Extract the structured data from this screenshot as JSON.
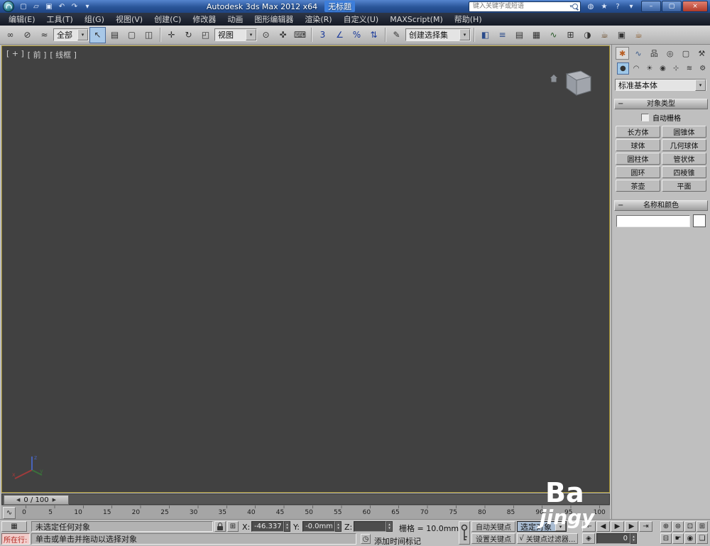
{
  "ui": {
    "arrow_down": "▾",
    "arrow_up": "▴",
    "arrow_left": "◀",
    "arrow_right": "▶",
    "collapse": "−",
    "listener_glyph": "▦",
    "absmode_glyph": "⊞",
    "clock_glyph": "◷",
    "keymode_glyph": "◈",
    "curve_glyph": "∿",
    "check": "√"
  },
  "titlebar": {
    "app_title": "Autodesk 3ds Max  2012 x64",
    "doc_title": "无标题",
    "search_placeholder": "键入关键字或短语",
    "qat_icons": [
      {
        "name": "new-scene-icon",
        "glyph": "▢"
      },
      {
        "name": "open-file-icon",
        "glyph": "▱"
      },
      {
        "name": "save-file-icon",
        "glyph": "▣"
      },
      {
        "name": "undo-icon",
        "glyph": "↶"
      },
      {
        "name": "redo-icon",
        "glyph": "↷"
      },
      {
        "name": "recent-dropdown-icon",
        "glyph": "▾"
      }
    ],
    "info_icons": [
      {
        "name": "communication-center-icon",
        "glyph": "◍"
      },
      {
        "name": "favorites-icon",
        "glyph": "★"
      },
      {
        "name": "help-icon",
        "glyph": "?"
      },
      {
        "name": "help-dropdown-icon",
        "glyph": "▾"
      }
    ],
    "window_buttons": [
      {
        "name": "minimize-button",
        "glyph": "–"
      },
      {
        "name": "maximize-button",
        "glyph": "▢"
      },
      {
        "name": "close-button",
        "glyph": "×",
        "cls": "close"
      }
    ]
  },
  "menus": [
    "编辑(E)",
    "工具(T)",
    "组(G)",
    "视图(V)",
    "创建(C)",
    "修改器",
    "动画",
    "图形编辑器",
    "渲染(R)",
    "自定义(U)",
    "MAXScript(M)",
    "帮助(H)"
  ],
  "toolbar": {
    "filter_label": "全部",
    "coord_label": "视图",
    "sets_label": "创建选择集",
    "groups": {
      "g1": [
        {
          "name": "select-and-link-icon",
          "glyph": "∞"
        },
        {
          "name": "unlink-selection-icon",
          "glyph": "⊘"
        },
        {
          "name": "bind-to-spacewarp-icon",
          "glyph": "≈"
        }
      ],
      "g2": [
        {
          "name": "select-object-icon",
          "glyph": "↖",
          "active": true
        },
        {
          "name": "select-by-name-icon",
          "glyph": "▤"
        },
        {
          "name": "rect-selection-icon",
          "glyph": "▢"
        },
        {
          "name": "window-crossing-icon",
          "glyph": "◫"
        }
      ],
      "g3": [
        {
          "name": "select-move-icon",
          "glyph": "✛"
        },
        {
          "name": "select-rotate-icon",
          "glyph": "↻"
        },
        {
          "name": "select-scale-icon",
          "glyph": "◰"
        }
      ],
      "g4": [
        {
          "name": "use-center-icon",
          "glyph": "⊙"
        },
        {
          "name": "select-manipulate-icon",
          "glyph": "✜"
        },
        {
          "name": "keyboard-override-icon",
          "glyph": "⌨"
        }
      ],
      "g5": [
        {
          "name": "snaps-toggle-icon",
          "glyph": "3",
          "color": "#1a3a9a"
        },
        {
          "name": "angle-snap-icon",
          "glyph": "∠",
          "color": "#1a3a9a"
        },
        {
          "name": "percent-snap-icon",
          "glyph": "%",
          "color": "#1a3a9a"
        },
        {
          "name": "spinner-snap-icon",
          "glyph": "⇅",
          "color": "#1a3a9a"
        }
      ],
      "g6": [
        {
          "name": "edit-named-selections-icon",
          "glyph": "✎"
        }
      ],
      "g7": [
        {
          "name": "mirror-icon",
          "glyph": "◧",
          "color": "#2a4a8a"
        },
        {
          "name": "align-icon",
          "glyph": "≡",
          "color": "#2a4a8a"
        },
        {
          "name": "layer-manager-icon",
          "glyph": "▤"
        },
        {
          "name": "graphite-toggle-icon",
          "glyph": "▦"
        },
        {
          "name": "curve-editor-icon",
          "glyph": "∿",
          "color": "#2a5a2a"
        },
        {
          "name": "schematic-view-icon",
          "glyph": "⊞"
        },
        {
          "name": "material-editor-icon",
          "glyph": "◑"
        },
        {
          "name": "render-setup-icon",
          "glyph": "☕",
          "color": "#6a4a28"
        },
        {
          "name": "rendered-frame-icon",
          "glyph": "▣"
        },
        {
          "name": "render-production-icon",
          "glyph": "☕",
          "color": "#8a5a2a"
        }
      ]
    }
  },
  "viewport": {
    "label_plus": "[ + ]",
    "label_view": "[ 前 ]",
    "label_shading": "[ 线框 ]"
  },
  "panel": {
    "tabs": [
      {
        "name": "tab-create-icon",
        "glyph": "✱",
        "active": true,
        "color": "#b85c20"
      },
      {
        "name": "tab-modify-icon",
        "glyph": "∿",
        "color": "#3a5a8a"
      },
      {
        "name": "tab-hierarchy-icon",
        "glyph": "品"
      },
      {
        "name": "tab-motion-icon",
        "glyph": "◎"
      },
      {
        "name": "tab-display-icon",
        "glyph": "▢"
      },
      {
        "name": "tab-utilities-icon",
        "glyph": "⚒"
      }
    ],
    "categories": [
      {
        "name": "cat-geometry-icon",
        "glyph": "●",
        "active": true
      },
      {
        "name": "cat-shapes-icon",
        "glyph": "◠"
      },
      {
        "name": "cat-lights-icon",
        "glyph": "☀"
      },
      {
        "name": "cat-cameras-icon",
        "glyph": "◉"
      },
      {
        "name": "cat-helpers-icon",
        "glyph": "⊹"
      },
      {
        "name": "cat-spacewarps-icon",
        "glyph": "≋"
      },
      {
        "name": "cat-systems-icon",
        "glyph": "⚙"
      }
    ],
    "dropdown": "标准基本体",
    "rollout_object_type": "对象类型",
    "autogrid": "自动栅格",
    "object_buttons": [
      "长方体",
      "圆锥体",
      "球体",
      "几何球体",
      "圆柱体",
      "管状体",
      "圆环",
      "四棱锥",
      "茶壶",
      "平面"
    ],
    "rollout_name_color": "名称和颜色"
  },
  "timeline": {
    "slider_label": "0 / 100",
    "ticks": [
      "0",
      "5",
      "10",
      "15",
      "20",
      "25",
      "30",
      "35",
      "40",
      "45",
      "50",
      "55",
      "60",
      "65",
      "70",
      "75",
      "80",
      "85",
      "90",
      "95",
      "100"
    ]
  },
  "status": {
    "listener_label": "所在行:",
    "status_line": "未选定任何对象",
    "prompt_line": "单击或单击并拖动以选择对象",
    "x_label": "X:",
    "x_value": "-46.337mm",
    "y_label": "Y:",
    "y_value": "-0.0mm",
    "z_label": "Z:",
    "z_value": "",
    "grid_label": "栅格 = 10.0mm",
    "add_time_tag": "添加时间标记",
    "auto_key": "自动关键点",
    "set_key": "设置关键点",
    "selected_obj": "选定对象",
    "key_filters": "关键点过滤器...",
    "frame_value": "0",
    "playback": [
      {
        "name": "go-to-start-icon",
        "glyph": "⇤"
      },
      {
        "name": "previous-frame-icon",
        "glyph": "◀"
      },
      {
        "name": "play-button-icon",
        "glyph": "▶"
      },
      {
        "name": "next-frame-icon",
        "glyph": "▶"
      },
      {
        "name": "go-to-end-icon",
        "glyph": "⇥"
      }
    ],
    "nav_icons": [
      {
        "name": "zoom-icon",
        "glyph": "⊕"
      },
      {
        "name": "zoom-all-icon",
        "glyph": "⊛"
      },
      {
        "name": "zoom-extents-icon",
        "glyph": "⊡"
      },
      {
        "name": "zoom-extents-all-icon",
        "glyph": "⊞"
      },
      {
        "name": "zoom-region-icon",
        "glyph": "⊟"
      },
      {
        "name": "pan-icon",
        "glyph": "☛"
      },
      {
        "name": "orbit-icon",
        "glyph": "◉"
      },
      {
        "name": "maximize-viewport-icon",
        "glyph": "❏"
      }
    ]
  },
  "watermark": {
    "line1": "Ba",
    "line2": "jingy"
  }
}
